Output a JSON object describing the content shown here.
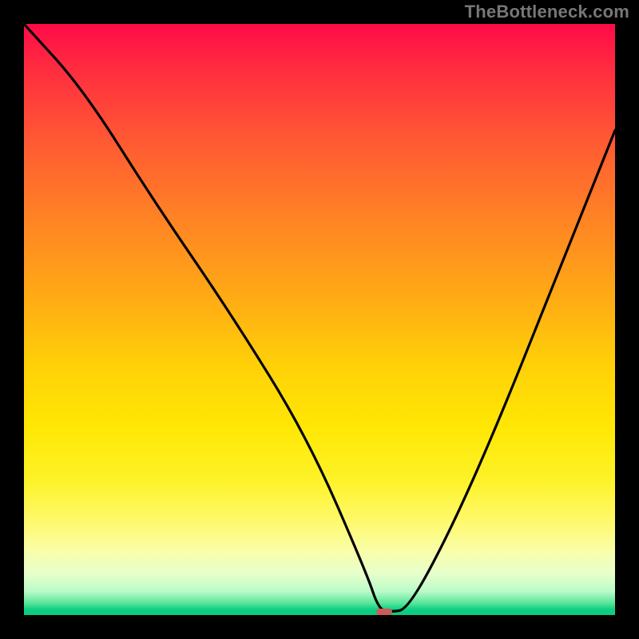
{
  "domain": "Chart",
  "watermark": "TheBottleneck.com",
  "chart_data": {
    "type": "line",
    "title": "",
    "xlabel": "",
    "ylabel": "",
    "xlim": [
      0,
      100
    ],
    "ylim": [
      0,
      100
    ],
    "x": [
      0,
      10,
      22,
      35,
      48,
      58,
      60,
      62,
      65,
      72,
      80,
      90,
      100
    ],
    "values": [
      100,
      89,
      70,
      51,
      30,
      7,
      1,
      0.5,
      1,
      14,
      32,
      57,
      82
    ],
    "marker": {
      "x": 61,
      "y": 0.5
    },
    "background_gradient": {
      "type": "vertical",
      "stops": [
        {
          "pos": 0.0,
          "color": "#ff0b47"
        },
        {
          "pos": 0.33,
          "color": "#ff8324"
        },
        {
          "pos": 0.68,
          "color": "#ffe704"
        },
        {
          "pos": 0.93,
          "color": "#e7ffcb"
        },
        {
          "pos": 1.0,
          "color": "#0cc97e"
        }
      ]
    }
  }
}
